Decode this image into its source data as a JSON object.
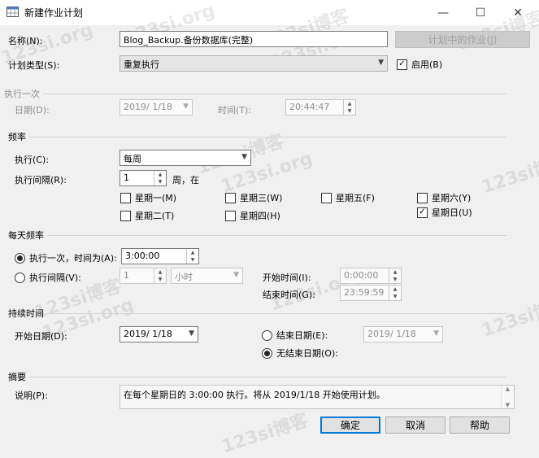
{
  "window": {
    "title": "新建作业计划",
    "minimize": "—",
    "maximize": "☐",
    "close": "✕"
  },
  "watermark": {
    "text1": "123si博客",
    "text2": "123si.org"
  },
  "name": {
    "label": "名称(N):",
    "value": "Blog_Backup.备份数据库(完整)",
    "jobs_button": "计划中的作业(J)"
  },
  "schedule_type": {
    "label": "计划类型(S):",
    "value": "重复执行",
    "enabled_label": "启用(B)",
    "enabled": true
  },
  "once": {
    "section": "执行一次",
    "date_label": "日期(D):",
    "date_value": "2019/ 1/18",
    "time_label": "时间(T):",
    "time_value": "20:44:47"
  },
  "frequency": {
    "section": "频率",
    "occurs_label": "执行(C):",
    "occurs_value": "每周",
    "recur_label": "执行间隔(R):",
    "recur_value": "1",
    "recur_unit": "周，在",
    "days": {
      "mon": "星期一(M)",
      "tue": "星期二(T)",
      "wed": "星期三(W)",
      "thu": "星期四(H)",
      "fri": "星期五(F)",
      "sat": "星期六(Y)",
      "sun": "星期日(U)"
    },
    "sunday_checked": true
  },
  "daily": {
    "section": "每天频率",
    "once_label": "执行一次，时间为(A):",
    "once_value": "3:00:00",
    "every_label": "执行间隔(V):",
    "every_value": "1",
    "every_unit": "小时",
    "start_label": "开始时间(I):",
    "start_value": "0:00:00",
    "end_label": "结束时间(G):",
    "end_value": "23:59:59"
  },
  "duration": {
    "section": "持续时间",
    "start_label": "开始日期(D):",
    "start_value": "2019/ 1/18",
    "end_label": "结束日期(E):",
    "end_value": "2019/ 1/18",
    "no_end_label": "无结束日期(O):"
  },
  "summary": {
    "section": "摘要",
    "desc_label": "说明(P):",
    "desc_value": "在每个星期日的 3:00:00 执行。将从 2019/1/18 开始使用计划。"
  },
  "buttons": {
    "ok": "确定",
    "cancel": "取消",
    "help": "帮助"
  },
  "icons": {
    "dropdown": "▼",
    "up": "▲",
    "down": "▼",
    "check": "✓"
  }
}
